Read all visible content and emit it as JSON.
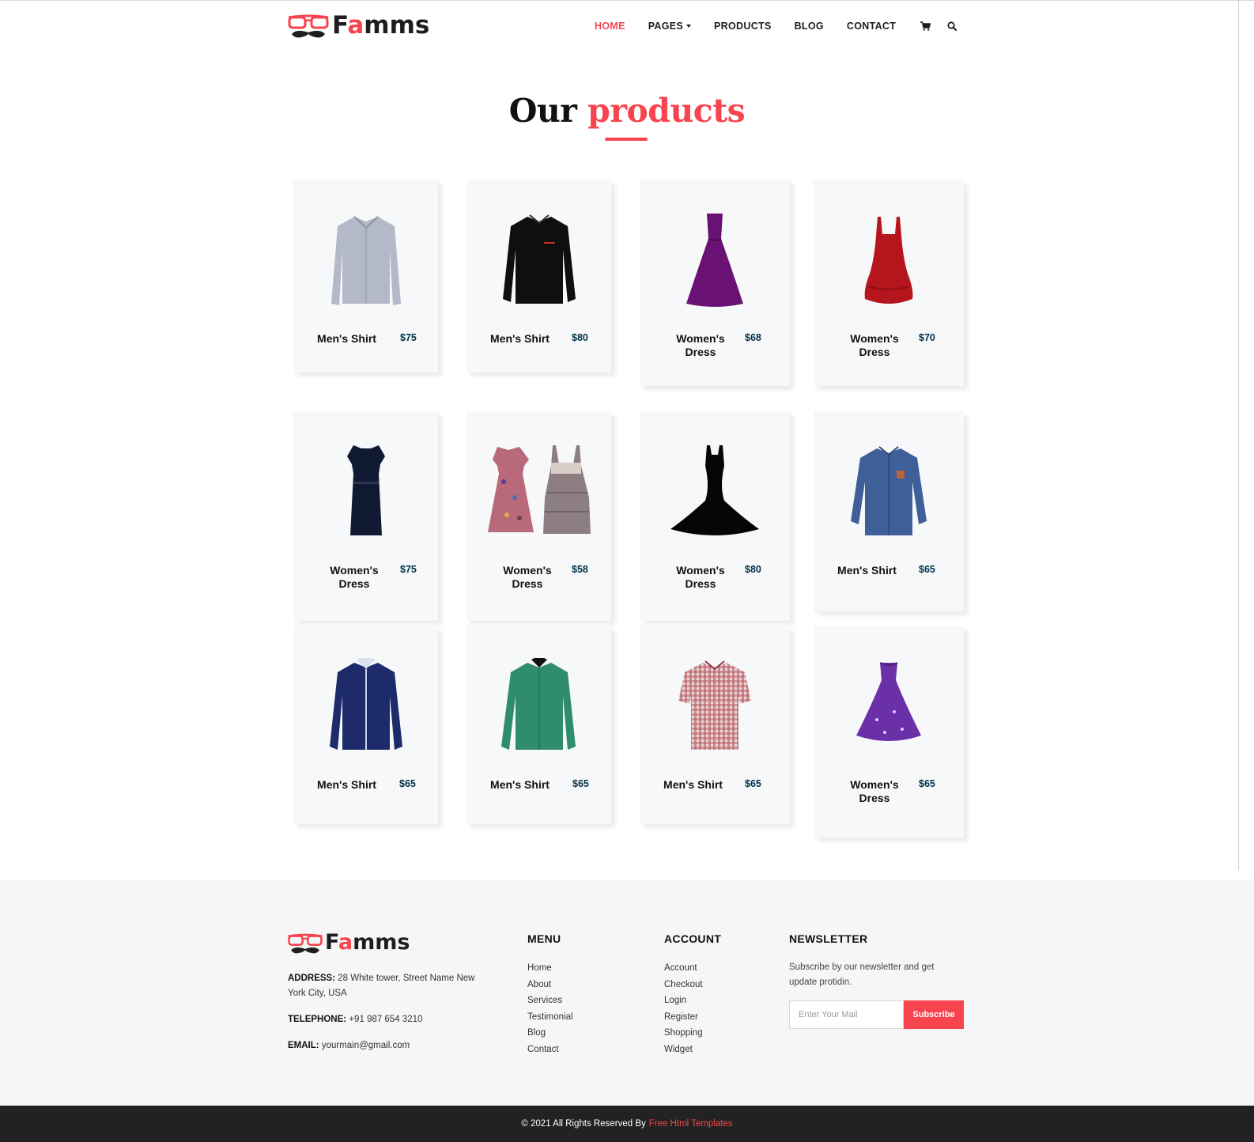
{
  "brand": {
    "logo_prefix": "F",
    "logo_accent": "a",
    "logo_suffix": "mms"
  },
  "nav": {
    "items": [
      "Home",
      "Pages",
      "Products",
      "Blog",
      "Contact"
    ],
    "active": "Home",
    "icons": [
      "cart-icon",
      "search-icon"
    ]
  },
  "heading": {
    "part1": "Our",
    "part2": "products"
  },
  "products": [
    {
      "name": "Men's Shirt",
      "price": "$75",
      "image": "grey-shirt"
    },
    {
      "name": "Men's Shirt",
      "price": "$80",
      "image": "black-shirt"
    },
    {
      "name": "Women's Dress",
      "price": "$68",
      "image": "purple-gown"
    },
    {
      "name": "Women's Dress",
      "price": "$70",
      "image": "red-dress"
    },
    {
      "name": "Women's Dress",
      "price": "$75",
      "image": "navy-dress"
    },
    {
      "name": "Women's Dress",
      "price": "$58",
      "image": "floral-and-tiered-dresses"
    },
    {
      "name": "Women's Dress",
      "price": "$80",
      "image": "black-gown"
    },
    {
      "name": "Men's Shirt",
      "price": "$65",
      "image": "blue-denim-shirt"
    },
    {
      "name": "Men's Shirt",
      "price": "$65",
      "image": "navy-shirt"
    },
    {
      "name": "Men's Shirt",
      "price": "$65",
      "image": "green-shirt"
    },
    {
      "name": "Men's Shirt",
      "price": "$65",
      "image": "checked-shirt"
    },
    {
      "name": "Women's Dress",
      "price": "$65",
      "image": "galaxy-gown"
    }
  ],
  "footer": {
    "address_label": "ADDRESS:",
    "address_line1": "28 White tower, Street Name New",
    "address_line2": "York City, USA",
    "telephone_label": "TELEPHONE:",
    "telephone": "+91 987 654 3210",
    "email_label": "EMAIL:",
    "email": "yourmain@gmail.com",
    "menu_title": "MENU",
    "menu": [
      "Home",
      "About",
      "Services",
      "Testimonial",
      "Blog",
      "Contact"
    ],
    "account_title": "ACCOUNT",
    "account": [
      "Account",
      "Checkout",
      "Login",
      "Register",
      "Shopping",
      "Widget"
    ],
    "newsletter_title": "NEWSLETTER",
    "newsletter_text_line1": "Subscribe by our newsletter and get",
    "newsletter_text_line2": "update protidin.",
    "input_placeholder": "Enter Your Mail",
    "subscribe_label": "Subscribe"
  },
  "copyright": {
    "text": "© 2021 All Rights Reserved By",
    "link": "Free Html Templates"
  },
  "colors": {
    "accent": "#f7444e",
    "dark": "#1e1e1e",
    "price": "#003049",
    "card_bg": "#f7f8f9",
    "footer_bg": "#f6f6f6",
    "copyright_bg": "#222222"
  }
}
